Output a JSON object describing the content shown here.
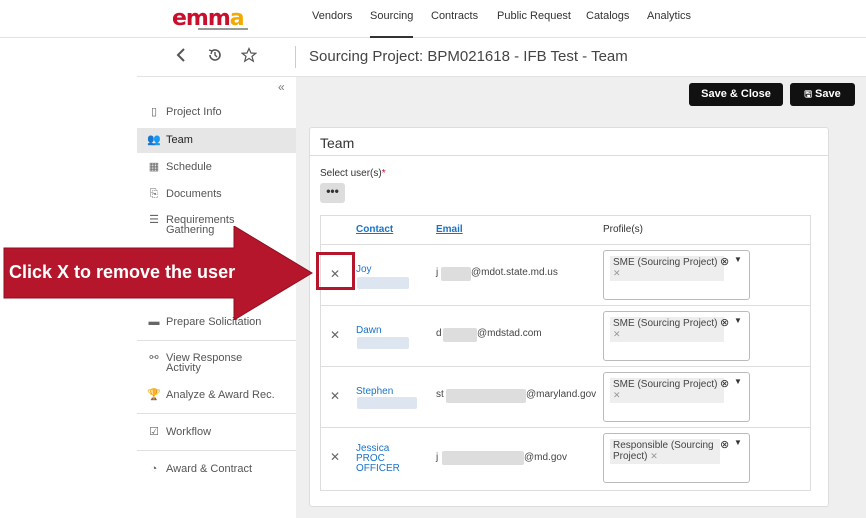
{
  "nav": {
    "logo": "emma",
    "items": [
      "Vendors",
      "Sourcing",
      "Contracts",
      "Public Request",
      "Catalogs",
      "Analytics"
    ]
  },
  "titlebar": {
    "back_icon": "chevron-left-icon",
    "history_icon": "history-icon",
    "star_icon": "star-icon",
    "title": "Sourcing Project: BPM021618 - IFB Test - Team"
  },
  "sidebar": {
    "collapse": "«",
    "items": [
      {
        "label": "Project Info",
        "icon": "document-icon"
      },
      {
        "label": "Team",
        "icon": "users-icon"
      },
      {
        "label": "Schedule",
        "icon": "calendar-icon"
      },
      {
        "label": "Documents",
        "icon": "files-icon"
      },
      {
        "label": "Requirements Gathering",
        "icon": "list-icon"
      },
      {
        "label": "Prepare Solicitation",
        "icon": "folder-icon"
      },
      {
        "label": "View Response Activity",
        "icon": "binoculars-icon"
      },
      {
        "label": "Analyze & Award Rec.",
        "icon": "trophy-icon"
      },
      {
        "label": "Workflow",
        "icon": "checkbox-icon"
      },
      {
        "label": "Award & Contract",
        "icon": "gauge-icon"
      }
    ]
  },
  "actions": {
    "save_close": "Save & Close",
    "save": "Save"
  },
  "panel": {
    "title": "Team",
    "select_label": "Select user(s)",
    "required_mark": "*",
    "dots": "•••"
  },
  "table": {
    "headers": {
      "contact": "Contact",
      "email": "Email",
      "profiles": "Profile(s)"
    },
    "rows": [
      {
        "contact": "Joy",
        "email": "@mdot.state.md.us",
        "email_prefix": "j",
        "profile": "SME (Sourcing Project)"
      },
      {
        "contact": "Dawn",
        "email": "@mdstad.com",
        "email_prefix": "d",
        "profile": "SME (Sourcing Project)"
      },
      {
        "contact": "Stephen",
        "email": "@maryland.gov",
        "email_prefix": "st",
        "profile": "SME (Sourcing Project)"
      },
      {
        "contact": "Jessica PROC OFFICER",
        "email": "@md.gov",
        "email_prefix": "j",
        "profile": "Responsible (Sourcing Project)"
      }
    ]
  },
  "callout": {
    "text": "Click X to remove the user",
    "color": "#b5162b"
  }
}
